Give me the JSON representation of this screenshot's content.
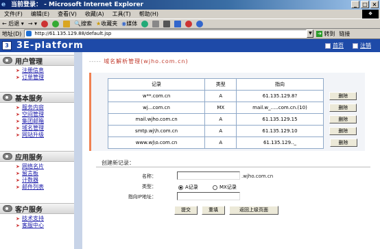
{
  "window": {
    "title": "当前登录：                  - Microsoft Internet Explorer"
  },
  "menu": [
    "文件(F)",
    "编辑(E)",
    "查看(V)",
    "收藏(A)",
    "工具(T)",
    "帮助(H)"
  ],
  "toolbar": {
    "back": "后退",
    "search": "搜索",
    "favorites": "收藏夹",
    "media": "媒体"
  },
  "address": {
    "label": "地址(D)",
    "url": "http://61.135.129.88/default.jsp",
    "go": "转到",
    "links": "链接"
  },
  "site": {
    "title": "3E-platform",
    "home": "首页",
    "logout": "注销"
  },
  "sidebar": [
    {
      "title": "用户管理",
      "items": [
        "注册信息",
        "订单管理"
      ]
    },
    {
      "title": "基本服务",
      "items": [
        "服务内容",
        "空间管理",
        "集团邮箱",
        "域名管理",
        "网站升级"
      ]
    },
    {
      "title": "应用服务",
      "items": [
        "网络名片",
        "留言板",
        "计数器",
        "邮件列表"
      ]
    },
    {
      "title": "客户服务",
      "items": [
        "技术支持",
        "客服中心"
      ]
    }
  ],
  "main": {
    "heading": "域名解析管理(wjho.com.cn)",
    "table": {
      "headers": [
        "记录",
        "类型",
        "指向"
      ],
      "rows": [
        {
          "record": "w**.com.cn",
          "type": "A",
          "target": "61.135.129.8?",
          "action": "删除"
        },
        {
          "record": "wj...com.cn",
          "type": "MX",
          "target": "mail.w_.....com.cn.(10)",
          "action": "删除"
        },
        {
          "record": "mail.wjho.com.cn",
          "type": "A",
          "target": "61.135.129.15",
          "action": "删除"
        },
        {
          "record": "smtp.wj\\h.com.cn",
          "type": "A",
          "target": "61.135.129.10",
          "action": "删除"
        },
        {
          "record": "www.wj\\o.com.cn",
          "type": "A",
          "target": "61.135.129.._",
          "action": "删除"
        }
      ]
    },
    "create": {
      "title": "创建新记录：",
      "name_label": "名称：",
      "name_suffix": ".wjho.com.cn",
      "type_label": "类型：",
      "type_a": "A记录",
      "type_mx": "MX记录",
      "ip_label": "指向IP地址：",
      "submit": "提交",
      "reset": "重填",
      "back": "返回上级页面"
    }
  }
}
